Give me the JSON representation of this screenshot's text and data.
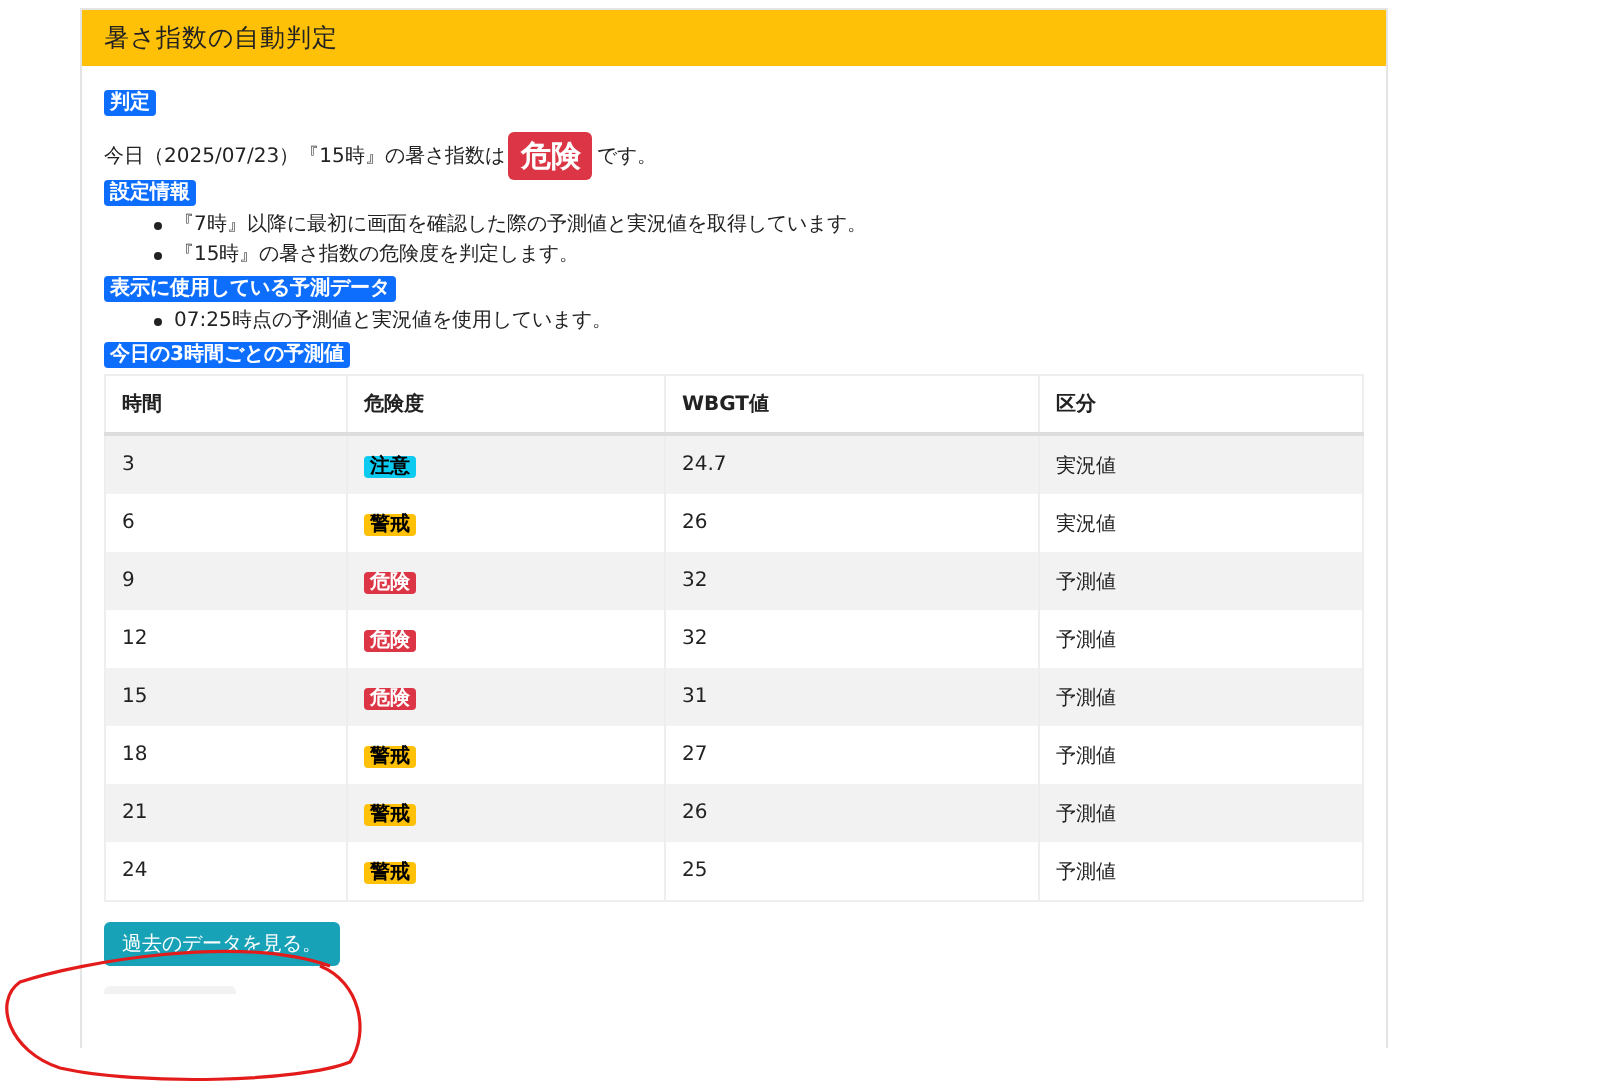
{
  "card": {
    "title": "暑さ指数の自動判定"
  },
  "sections": [
    {
      "heading": "判定",
      "kind": "verdict",
      "before": "今日（2025/07/23）『15時』の暑さ指数は",
      "badge": "危険",
      "color": "#dc3545",
      "after": "です。"
    },
    {
      "heading": "設定情報",
      "kind": "list",
      "items": [
        "『7時』以降に最初に画面を確認した際の予測値と実況値を取得しています。",
        "『15時』の暑さ指数の危険度を判定します。"
      ]
    },
    {
      "heading": "表示に使用している予測データ",
      "kind": "list",
      "items": [
        "07:25時点の予測値と実況値を使用しています。"
      ]
    },
    {
      "heading": "今日の3時間ごとの予測値",
      "kind": "table"
    }
  ],
  "table": {
    "columns": [
      "時間",
      "危険度",
      "WBGT値",
      "区分"
    ],
    "rows": [
      {
        "hour": "3",
        "risk": "注意",
        "color": "#0dcaf0",
        "wbgt": "24.7",
        "type": "実況値"
      },
      {
        "hour": "6",
        "risk": "警戒",
        "color": "#ffc107",
        "wbgt": "26",
        "type": "実況値"
      },
      {
        "hour": "9",
        "risk": "危険",
        "color": "#dc3545",
        "wbgt": "32",
        "type": "予測値"
      },
      {
        "hour": "12",
        "risk": "危険",
        "color": "#dc3545",
        "wbgt": "32",
        "type": "予測値"
      },
      {
        "hour": "15",
        "risk": "危険",
        "color": "#dc3545",
        "wbgt": "31",
        "type": "予測値"
      },
      {
        "hour": "18",
        "risk": "警戒",
        "color": "#ffc107",
        "wbgt": "27",
        "type": "予測値"
      },
      {
        "hour": "21",
        "risk": "警戒",
        "color": "#ffc107",
        "wbgt": "26",
        "type": "予測値"
      },
      {
        "hour": "24",
        "risk": "警戒",
        "color": "#ffc107",
        "wbgt": "25",
        "type": "予測値"
      }
    ]
  },
  "button": "過去のデータを見る。"
}
